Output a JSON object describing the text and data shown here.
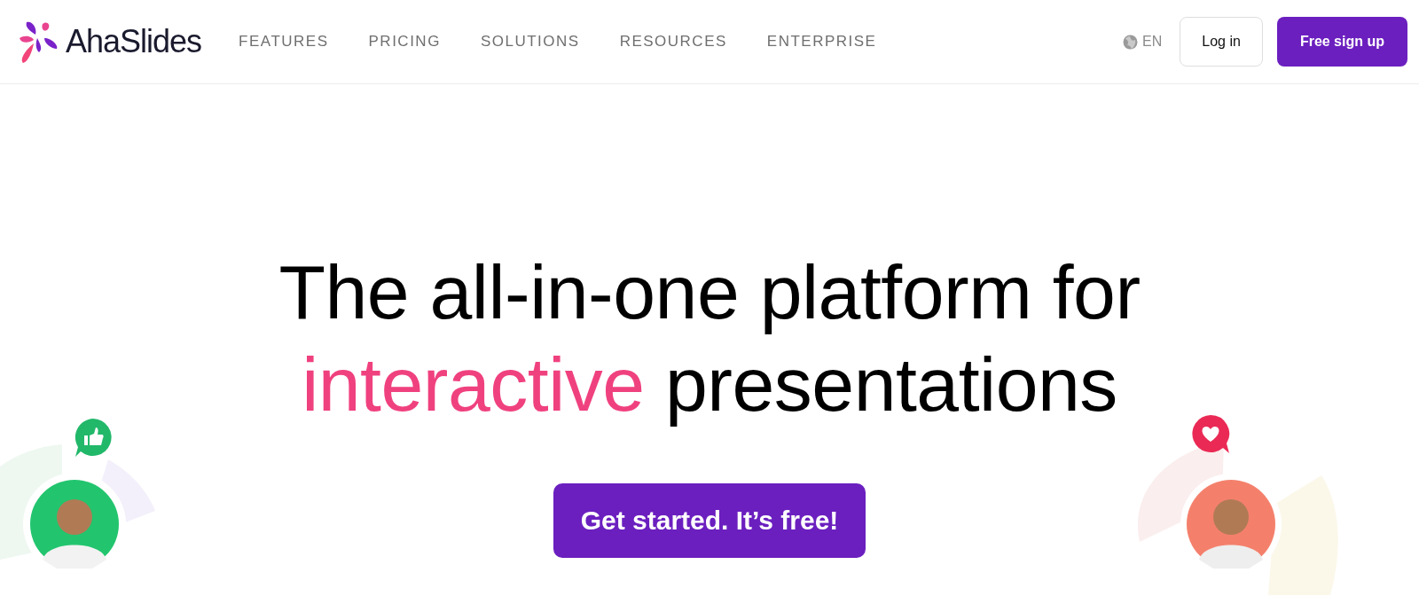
{
  "header": {
    "logo": "AhaSlides",
    "nav": [
      {
        "label": "FEATURES"
      },
      {
        "label": "PRICING"
      },
      {
        "label": "SOLUTIONS"
      },
      {
        "label": "RESOURCES"
      },
      {
        "label": "ENTERPRISE"
      }
    ],
    "language": "EN",
    "login": "Log in",
    "signup": "Free sign up"
  },
  "hero": {
    "title_line1": "The all-in-one platform for",
    "highlight": "interactive",
    "title_rest": "presentations",
    "cta": "Get started. It’s free!"
  },
  "reactions": [
    {
      "kind": "like",
      "color": "#22b86a"
    },
    {
      "kind": "heart",
      "color": "#ea2a55"
    }
  ]
}
